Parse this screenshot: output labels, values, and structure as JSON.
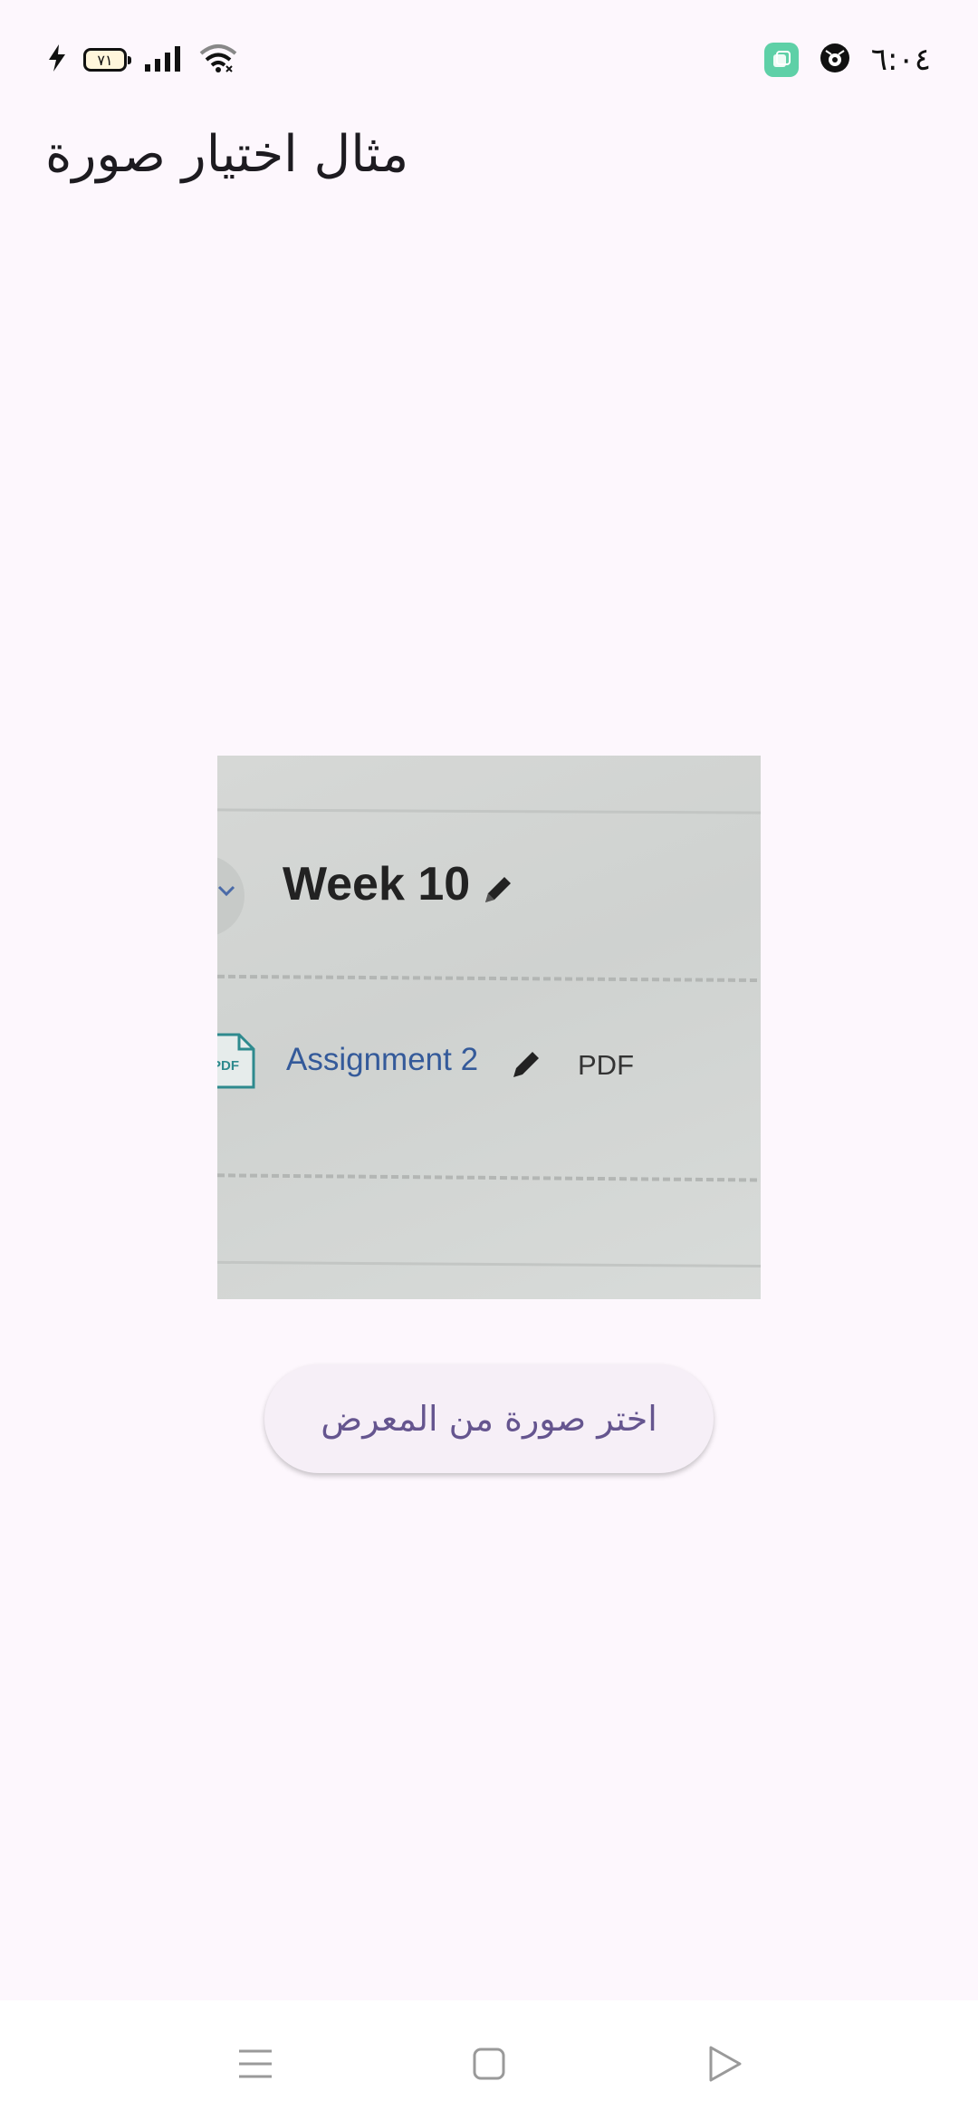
{
  "status_bar": {
    "time": "٦:٠٤",
    "battery_level": "٧١",
    "icons": [
      "app-badge-icon",
      "privacy-icon",
      "charging-icon",
      "battery-icon",
      "signal-icon",
      "wifi-icon"
    ]
  },
  "app_bar": {
    "title": "مثال اختيار صورة"
  },
  "picked_image": {
    "week_title": "Week 10",
    "assignment_link": "Assignment 2",
    "file_type": "PDF",
    "pdf_icon_text": "PDF",
    "icons": [
      "chevron-icon",
      "pencil-icon",
      "pdf-file-icon"
    ]
  },
  "actions": {
    "pick_from_gallery_label": "اختر صورة من المعرض"
  },
  "nav_bar": {
    "buttons": [
      "menu-icon",
      "home-icon",
      "back-icon"
    ]
  },
  "colors": {
    "background": "#fdf7fd",
    "button_text": "#65558f",
    "button_bg": "#f6eff7",
    "status_badge": "#5ed0a7"
  }
}
